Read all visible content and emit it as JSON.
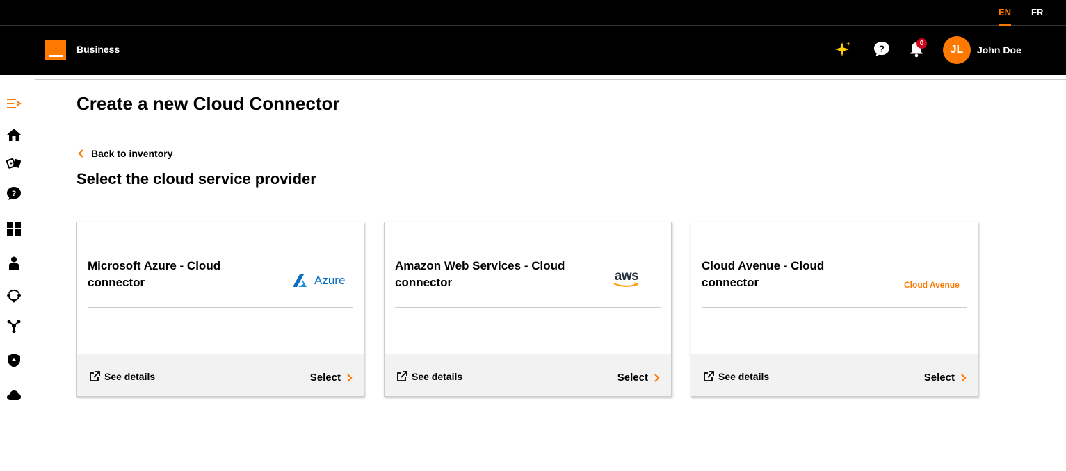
{
  "lang": {
    "en": "EN",
    "fr": "FR"
  },
  "header": {
    "brand": "Business",
    "notifications_count": "0",
    "avatar_initials": "JL",
    "user_name": "John Doe"
  },
  "sidebar": {
    "items": [
      "menu-toggle-icon",
      "home-icon",
      "tickets-icon",
      "help-icon",
      "dashboard-icon",
      "user-icon",
      "network-icon",
      "topology-icon",
      "security-icon",
      "cloud-icon"
    ]
  },
  "main": {
    "title": "Create a new Cloud Connector",
    "back_label": "Back to inventory",
    "section_title": "Select the cloud service provider"
  },
  "cards": [
    {
      "title": "Microsoft Azure - Cloud connector",
      "logo_text": "Azure",
      "see_details": "See details",
      "select": "Select"
    },
    {
      "title": "Amazon Web Services - Cloud connector",
      "logo_text": "aws",
      "see_details": "See details",
      "select": "Select"
    },
    {
      "title": "Cloud Avenue - Cloud connector",
      "logo_text": "Cloud Avenue",
      "see_details": "See details",
      "select": "Select"
    }
  ],
  "colors": {
    "accent": "#ff7900",
    "header_bg": "#000000",
    "footer_bg": "#f2f2f2",
    "azure_blue": "#0a6fc2",
    "badge_red": "#d0021b"
  }
}
